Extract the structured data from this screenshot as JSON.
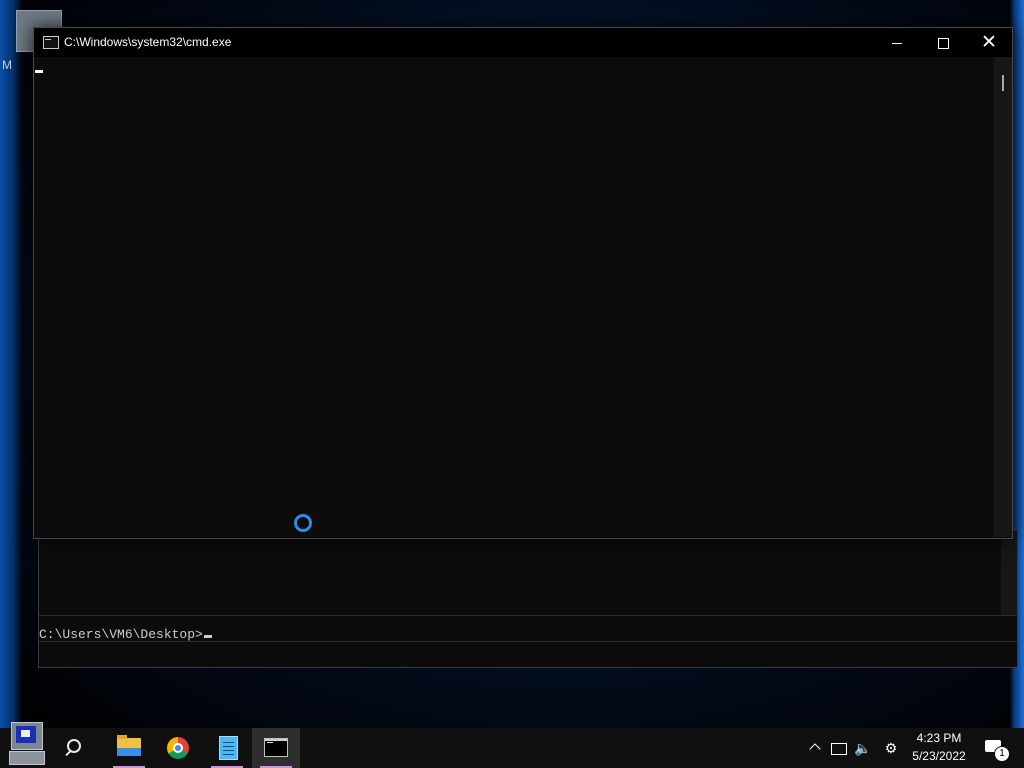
{
  "desktop": {
    "icon_label_fragment": "M"
  },
  "cmd_window": {
    "title": "C:\\Windows\\system32\\cmd.exe",
    "controls": {
      "minimize": "minimize",
      "maximize": "maximize",
      "close": "✕"
    }
  },
  "background_console": {
    "prompt": "C:\\Users\\VM6\\Desktop>"
  },
  "taskbar": {
    "apps": [
      "start",
      "search",
      "file-explorer",
      "google-chrome",
      "notepad",
      "command-prompt"
    ],
    "tray_icons": [
      "chevron-up-icon",
      "network-icon",
      "volume-icon",
      "pen-settings-icon"
    ],
    "clock": {
      "time": "4:23 PM",
      "date": "5/23/2022"
    },
    "notifications": {
      "count": "1"
    }
  },
  "colors": {
    "console_bg": "#0c0c0c",
    "titlebar_bg": "#000000",
    "taskbar_bg": "#101010",
    "busy_spinner": "#2f8be8",
    "active_app_underline": "#d48fe0"
  }
}
